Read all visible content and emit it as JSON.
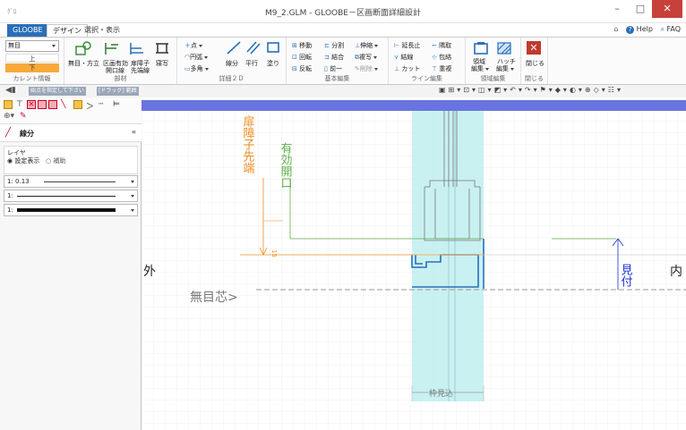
{
  "window": {
    "title": "M9_2.GLM - GLOOBE－区画断面詳細設計",
    "app_icon": "ｸﾞﾛ"
  },
  "tabs": [
    {
      "label": "GLOOBE"
    },
    {
      "label": "デザイン"
    },
    {
      "label": "選択・表示"
    }
  ],
  "help": {
    "help_label": "Help",
    "faq_label": "FAQ"
  },
  "ribbon": {
    "current": {
      "value": "無目",
      "up_label": "上",
      "down_label": "下",
      "group_label": "カレント情報"
    },
    "parts": {
      "btn1": "無目・方立",
      "btn2a": "区画有効",
      "btn2b": "開口線",
      "btn3a": "扉障子",
      "btn3b": "先端線",
      "btn4": "寝写",
      "group_label": "部材"
    },
    "detail2d": {
      "point": "点",
      "arc": "円弧",
      "poly": "多角",
      "segment": "線分",
      "parallel": "平行",
      "fill": "塗り",
      "group_label": "詳細２Ｄ"
    },
    "basic": {
      "move": "移動",
      "rotate": "回転",
      "mirror": "反転",
      "divide": "分割",
      "join": "結合",
      "front": "前一",
      "extend": "伸縮",
      "copy": "複写",
      "delete": "削除",
      "group_label": "基本編集"
    },
    "line": {
      "extend_stop": "延長止",
      "corner": "隅取",
      "connect": "結線",
      "cover": "包絡",
      "cut": "カット",
      "overlap": "重複",
      "group_label": "ライン編集"
    },
    "region": {
      "region_edit": "領域",
      "region_edit2": "編集",
      "hatch": "ハッチ",
      "hatch2": "編集",
      "group_label": "領域編集"
    },
    "close": {
      "label": "閉じる",
      "group_label": "閉じる"
    }
  },
  "toolbar2": {
    "hint1": "始点を指定して下さい",
    "hint2": "[ドラッグ] 範囲"
  },
  "leftpane": {
    "title": "線分",
    "layer_label": "レイヤ",
    "radio1": "設定表示",
    "radio2": "補助",
    "rows": [
      {
        "label": "1: 0.13"
      },
      {
        "label": "1:"
      },
      {
        "label": "1:"
      }
    ]
  },
  "drawing": {
    "left_label": "外",
    "right_label": "内",
    "mullion_center": "無目芯",
    "door_tip": "扉障子先端",
    "effective_opening": "有効開口",
    "dim_15": "15",
    "mitsuke": "見付",
    "frame_visible": "枠見込"
  },
  "colors": {
    "accent": "#2a6fb8",
    "orange": "#f08c1e",
    "green": "#5fae4a",
    "cyan_band": "#bfeff0",
    "blue_text": "#1a2fd6"
  }
}
